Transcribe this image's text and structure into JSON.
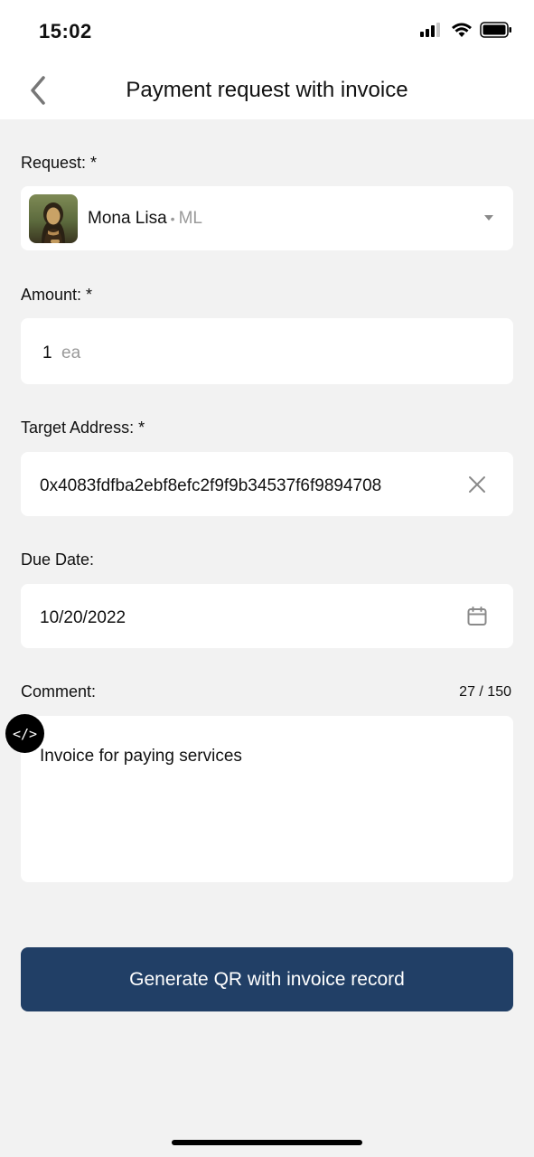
{
  "status": {
    "time": "15:02"
  },
  "header": {
    "title": "Payment request with invoice",
    "back_icon": "chevron-left-icon"
  },
  "request": {
    "label": "Request: *",
    "name": "Mona Lisa",
    "separator": "•",
    "code": "ML"
  },
  "amount": {
    "label": "Amount: *",
    "value": "1",
    "unit": "ea"
  },
  "target": {
    "label": "Target Address: *",
    "value": "0x4083fdfba2ebf8efc2f9f9b34537f6f9894708",
    "clear_icon": "close-icon"
  },
  "due": {
    "label": "Due Date:",
    "value": "10/20/2022",
    "calendar_icon": "calendar-icon"
  },
  "comment": {
    "label": "Comment:",
    "counter": "27 / 150",
    "value": "Invoice for paying services",
    "badge": "</>"
  },
  "action": {
    "label": "Generate QR with invoice record",
    "color": "#213f66"
  }
}
